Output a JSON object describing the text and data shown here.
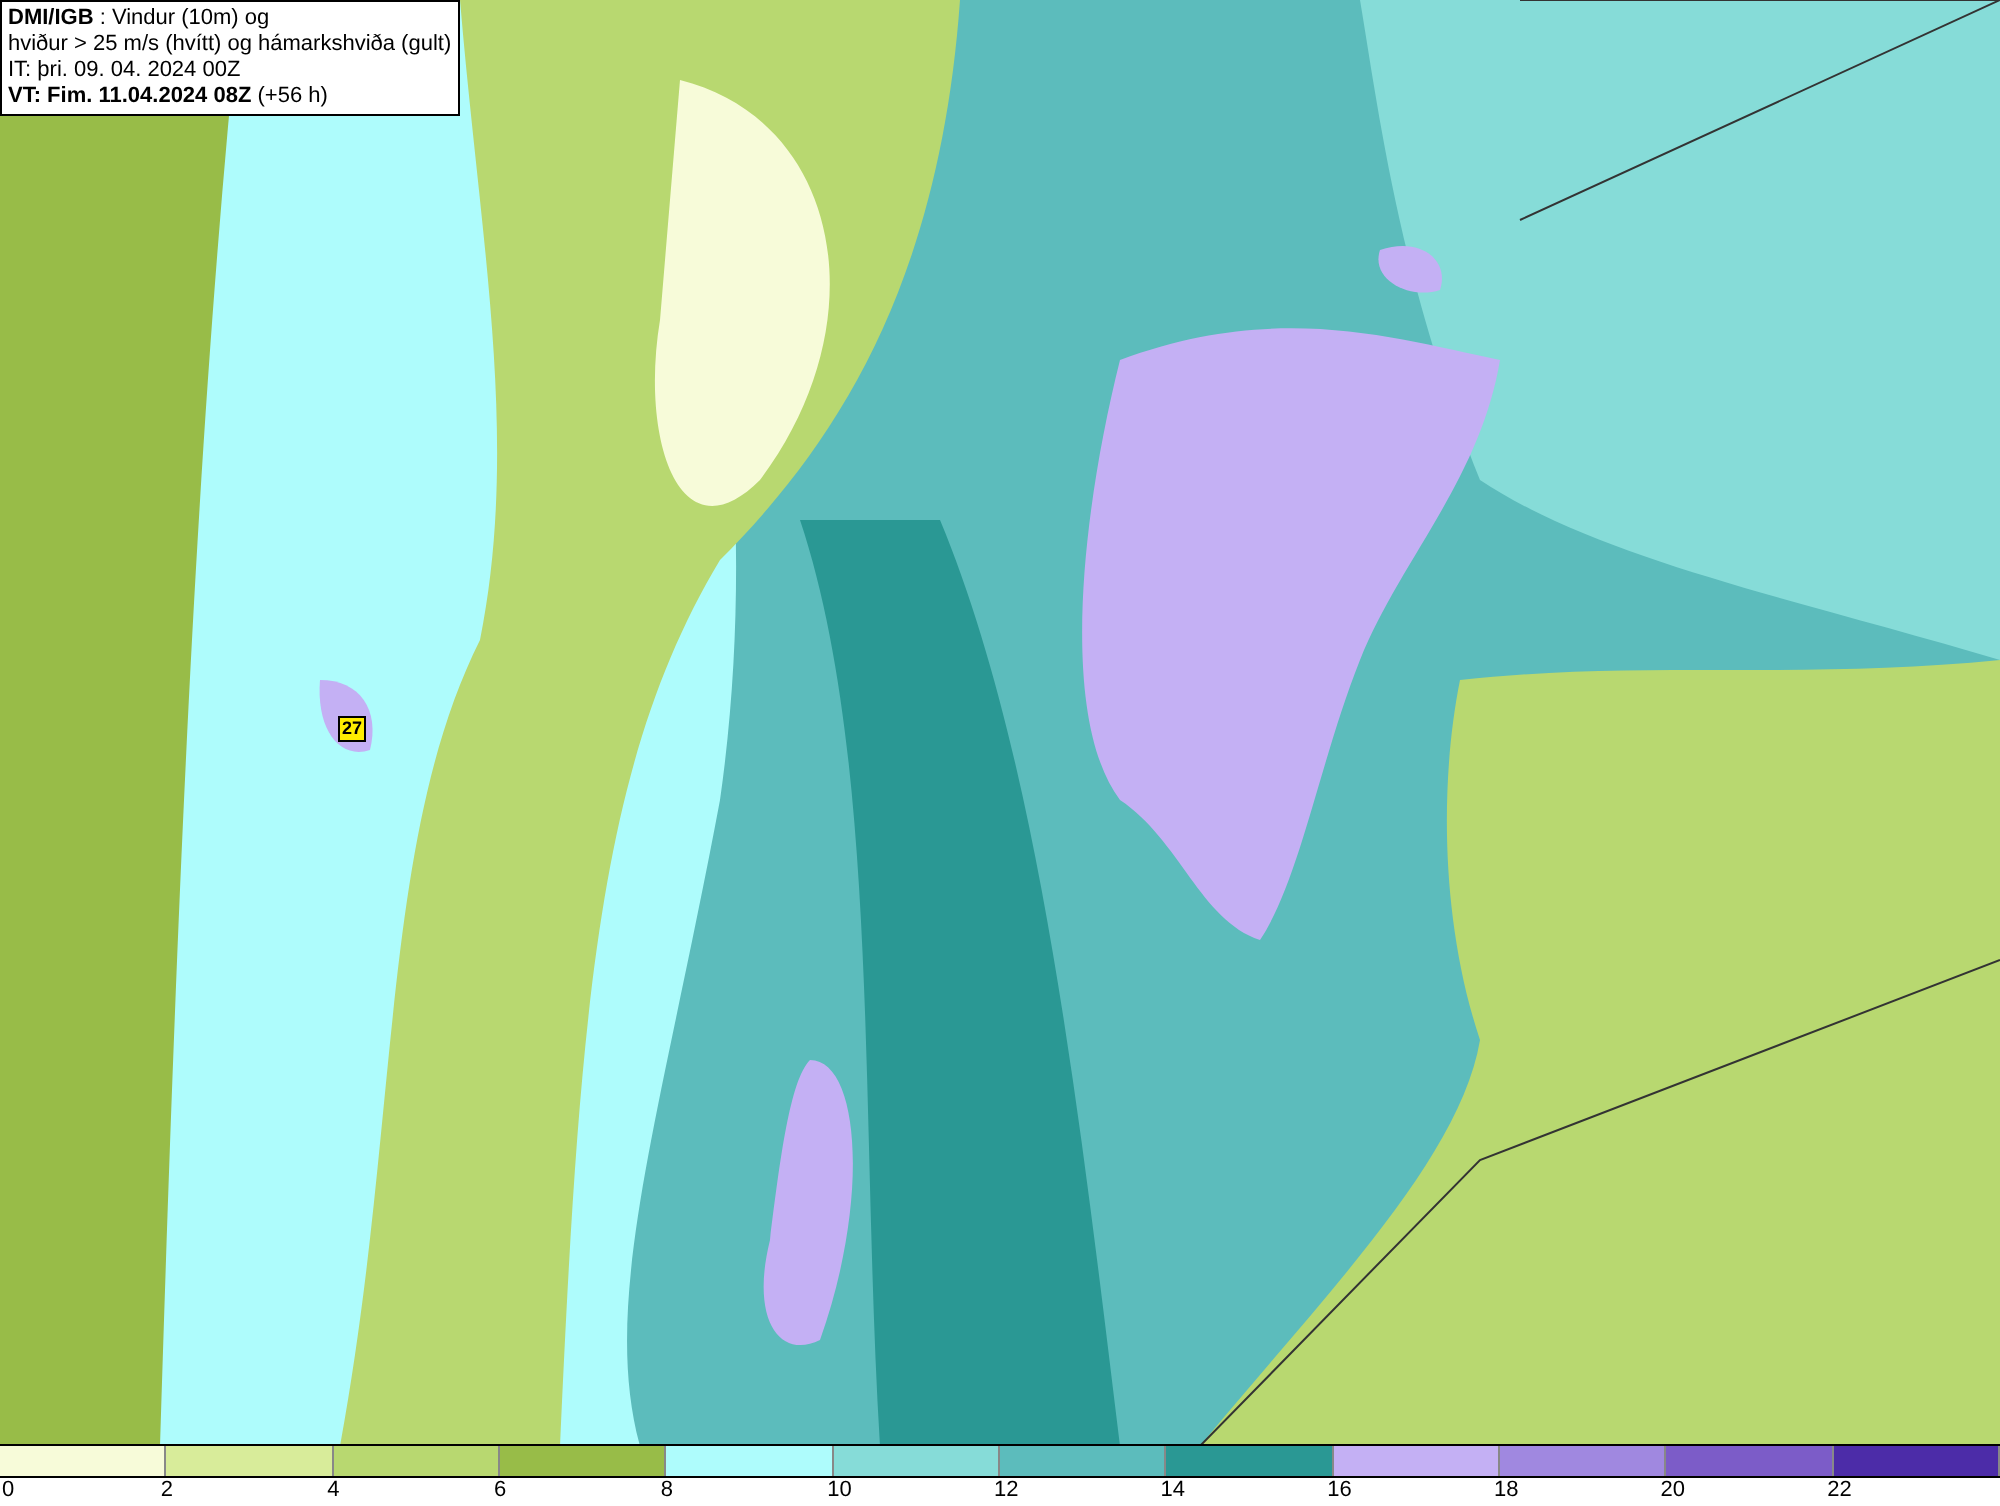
{
  "header": {
    "lines": [
      "**DMI/IGB** : Vindur (10m) og",
      "hviður > 25 m/s (hvítt) og hámarkshviða (gult)",
      "IT: þri. 09. 04. 2024 00Z",
      "**VT: Fim. 11.04.2024 08Z** (+56 h)"
    ]
  },
  "map": {
    "gust_marker": "27"
  },
  "legend": [
    {
      "label": "0",
      "color": "#f7fbd9"
    },
    {
      "label": "2",
      "color": "#d8ec9a"
    },
    {
      "label": "4",
      "color": "#b8d870"
    },
    {
      "label": "6",
      "color": "#98bc48"
    },
    {
      "label": "8",
      "color": "#aefcfc"
    },
    {
      "label": "10",
      "color": "#86dcd8"
    },
    {
      "label": "12",
      "color": "#5cbcbc"
    },
    {
      "label": "14",
      "color": "#2a9894"
    },
    {
      "label": "16",
      "color": "#c4b0f4"
    },
    {
      "label": "18",
      "color": "#a088e0"
    },
    {
      "label": "20",
      "color": "#7c5cc8"
    },
    {
      "label": "22",
      "color": "#4c2ca8"
    }
  ]
}
